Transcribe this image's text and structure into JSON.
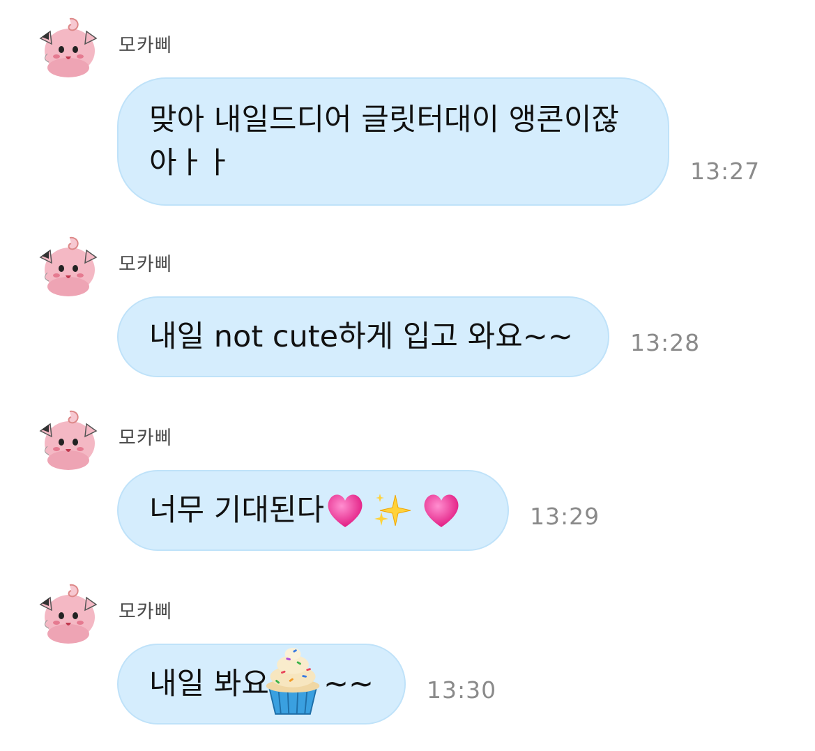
{
  "messages": [
    {
      "sender": "모카삐",
      "parts": [
        "맞아 내일드디어 글릿터대이 앵콘이잖아ㅏㅏ"
      ],
      "time": "13:27"
    },
    {
      "sender": "모카삐",
      "parts": [
        "내일 not cute하게 입고 와요~~"
      ],
      "time": "13:28"
    },
    {
      "sender": "모카삐",
      "parts": [
        "너무 기대된다"
      ],
      "emojis": [
        "heart-emoji",
        "sparkles-emoji",
        "heart-emoji"
      ],
      "time": "13:29"
    },
    {
      "sender": "모카삐",
      "parts": [
        "내일 봐요",
        "~~"
      ],
      "emojis": [
        "cupcake-emoji"
      ],
      "time": "13:30"
    }
  ],
  "colors": {
    "bubble_bg": "#d5edfd",
    "bubble_border": "#bfe2f9",
    "time_text": "#8a8a8a",
    "sender_text": "#4a4a4a"
  }
}
